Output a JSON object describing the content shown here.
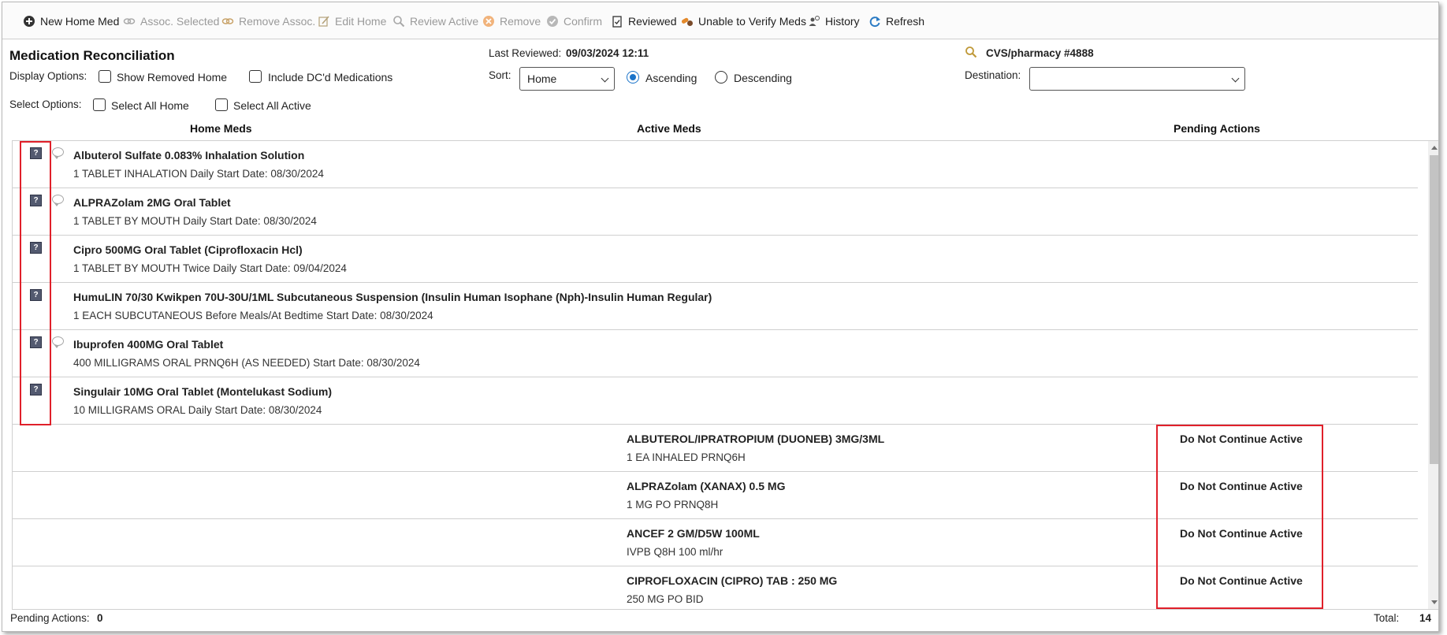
{
  "toolbar": {
    "new_home_med": "New Home Med",
    "assoc_selected": "Assoc. Selected",
    "remove_assoc": "Remove Assoc.",
    "edit_home": "Edit Home",
    "review_active": "Review Active",
    "remove": "Remove",
    "confirm": "Confirm",
    "reviewed": "Reviewed",
    "unable_to_verify": "Unable to Verify Meds",
    "history": "History",
    "refresh": "Refresh"
  },
  "header": {
    "title": "Medication Reconciliation",
    "display_options_label": "Display Options:",
    "show_removed_home": "Show Removed Home",
    "include_dc_meds": "Include DC'd Medications",
    "select_options_label": "Select Options:",
    "select_all_home": "Select All Home",
    "select_all_active": "Select All Active",
    "last_reviewed_label": "Last Reviewed:",
    "last_reviewed_value": "09/03/2024 12:11",
    "sort_label": "Sort:",
    "sort_value": "Home",
    "ascending": "Ascending",
    "descending": "Descending",
    "pharmacy": "CVS/pharmacy #4888",
    "destination_label": "Destination:",
    "destination_value": ""
  },
  "columns": {
    "home": "Home Meds",
    "active": "Active Meds",
    "pending": "Pending Actions"
  },
  "home_meds": [
    {
      "name": "Albuterol Sulfate 0.083% Inhalation Solution",
      "sig": "1 TABLET INHALATION Daily Start Date: 08/30/2024",
      "comment": true
    },
    {
      "name": "ALPRAZolam 2MG Oral Tablet",
      "sig": "1 TABLET BY MOUTH Daily Start Date: 08/30/2024",
      "comment": true
    },
    {
      "name": "Cipro 500MG Oral Tablet (Ciprofloxacin Hcl)",
      "sig": "1 TABLET BY MOUTH Twice Daily Start Date: 09/04/2024",
      "comment": false
    },
    {
      "name": "HumuLIN 70/30 Kwikpen 70U-30U/1ML Subcutaneous Suspension (Insulin Human Isophane (Nph)-Insulin Human Regular)",
      "sig": "1 EACH SUBCUTANEOUS Before Meals/At Bedtime Start Date: 08/30/2024",
      "comment": false
    },
    {
      "name": "Ibuprofen 400MG Oral Tablet",
      "sig": "400 MILLIGRAMS ORAL PRNQ6H (AS NEEDED) Start Date: 08/30/2024",
      "comment": true
    },
    {
      "name": "Singulair 10MG Oral Tablet (Montelukast Sodium)",
      "sig": "10 MILLIGRAMS ORAL Daily Start Date: 08/30/2024",
      "comment": false
    }
  ],
  "active_meds": [
    {
      "name": "ALBUTEROL/IPRATROPIUM (DUONEB) 3MG/3ML",
      "sig": "1 EA INHALED PRNQ6H",
      "action": "Do Not Continue Active"
    },
    {
      "name": "ALPRAZolam (XANAX) 0.5 MG",
      "sig": "1 MG PO PRNQ8H",
      "action": "Do Not Continue Active"
    },
    {
      "name": "ANCEF 2 GM/D5W 100ML",
      "sig": "IVPB Q8H 100 ml/hr",
      "action": "Do Not Continue Active"
    },
    {
      "name": "CIPROFLOXACIN (CIPRO) TAB : 250 MG",
      "sig": "250 MG PO BID",
      "action": "Do Not Continue Active"
    }
  ],
  "footer": {
    "pending_label": "Pending Actions:",
    "pending_value": "0",
    "total_label": "Total:",
    "total_value": "14"
  }
}
